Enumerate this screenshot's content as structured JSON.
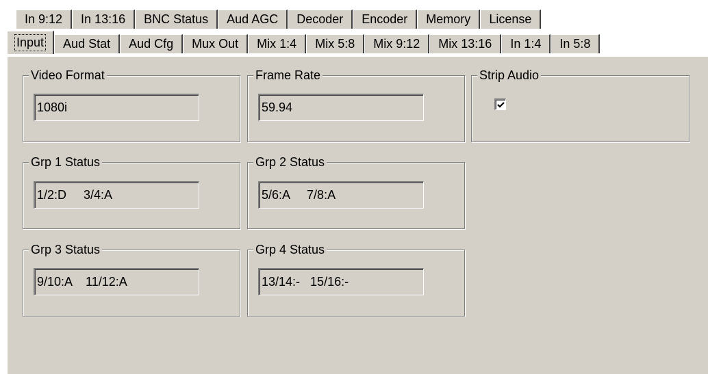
{
  "tabs": {
    "back_row": [
      "In 9:12",
      "In 13:16",
      "BNC Status",
      "Aud AGC",
      "Decoder",
      "Encoder",
      "Memory",
      "License"
    ],
    "front_row": [
      "Input",
      "Aud Stat",
      "Aud Cfg",
      "Mux Out",
      "Mix 1:4",
      "Mix 5:8",
      "Mix 9:12",
      "Mix 13:16",
      "In 1:4",
      "In 5:8"
    ],
    "active": "Input"
  },
  "groups": {
    "video_format": {
      "label": "Video Format",
      "value": "1080i"
    },
    "frame_rate": {
      "label": "Frame Rate",
      "value": "59.94"
    },
    "strip_audio": {
      "label": "Strip Audio",
      "checked": true
    },
    "grp1": {
      "label": "Grp 1 Status",
      "value": "1/2:D     3/4:A"
    },
    "grp2": {
      "label": "Grp 2 Status",
      "value": "5/6:A     7/8:A"
    },
    "grp3": {
      "label": "Grp 3 Status",
      "value": "9/10:A    11/12:A"
    },
    "grp4": {
      "label": "Grp 4 Status",
      "value": "13/14:-   15/16:-"
    }
  }
}
